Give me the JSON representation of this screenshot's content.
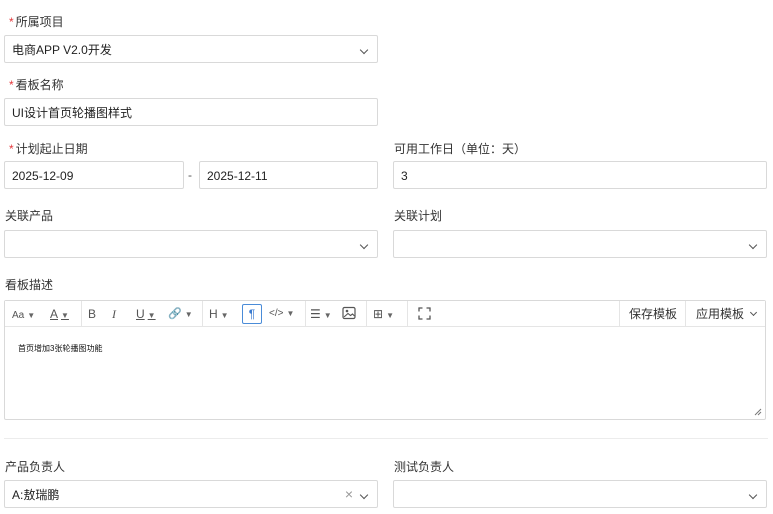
{
  "project": {
    "label": "所属项目",
    "value": "电商APP V2.0开发"
  },
  "board_name": {
    "label": "看板名称",
    "value": "UI设计首页轮播图样式"
  },
  "plan_dates": {
    "label": "计划起止日期",
    "start": "2025-12-09",
    "separator": "-",
    "end": "2025-12-11"
  },
  "workdays": {
    "label": "可用工作日（单位：天）",
    "value": "3"
  },
  "related_product": {
    "label": "关联产品",
    "value": ""
  },
  "related_plan": {
    "label": "关联计划",
    "value": ""
  },
  "description": {
    "label": "看板描述",
    "toolbar": {
      "font_size": "Aa",
      "font_color": "A",
      "bold": "B",
      "italic": "I",
      "underline": "U",
      "link": "🔗",
      "heading": "H",
      "paragraph": "¶",
      "code": "</>",
      "list": "☰",
      "table": "⊞",
      "fullscreen": "⛶",
      "save_template": "保存模板",
      "apply_template": "应用模板"
    },
    "content": "首页增加3张轮播图功能"
  },
  "product_owner": {
    "label": "产品负责人",
    "value": "A:敖瑞鹏",
    "clear": "×"
  },
  "test_owner": {
    "label": "测试负责人",
    "value": ""
  }
}
